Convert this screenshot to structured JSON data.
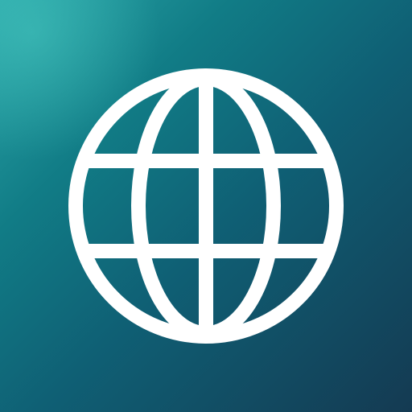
{
  "icon": {
    "name": "globe-icon",
    "stroke_color": "#ffffff",
    "background_colors": [
      "#2aa6a8",
      "#117c86",
      "#0f5f74",
      "#143a52"
    ]
  }
}
